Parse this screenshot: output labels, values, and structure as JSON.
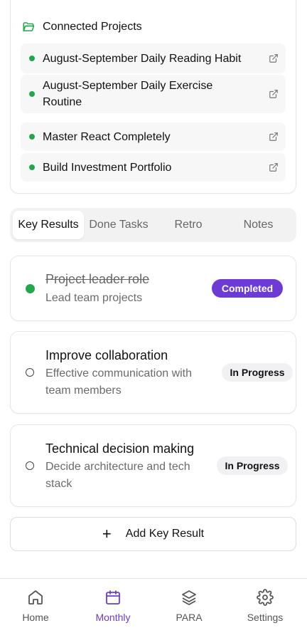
{
  "projects": {
    "title": "Connected Projects",
    "items": [
      {
        "name": "August-September Daily Reading Habit"
      },
      {
        "name": "August-September Daily Exercise Routine"
      },
      {
        "name": "Master React Completely"
      },
      {
        "name": "Build Investment Portfolio"
      }
    ]
  },
  "tabs": [
    "Key Results",
    "Done Tasks",
    "Retro",
    "Notes"
  ],
  "active_tab": "Key Results",
  "key_results": [
    {
      "title": "Project leader role",
      "desc": "Lead team projects",
      "status": "Completed",
      "done": true
    },
    {
      "title": "Improve collaboration",
      "desc": "Effective communication with team members",
      "status": "In Progress",
      "done": false
    },
    {
      "title": "Technical decision making",
      "desc": "Decide architecture and tech stack",
      "status": "In Progress",
      "done": false
    }
  ],
  "add_key_result": "Add Key Result",
  "nav": [
    {
      "label": "Home",
      "icon": "home-icon"
    },
    {
      "label": "Monthly",
      "icon": "calendar-icon"
    },
    {
      "label": "PARA",
      "icon": "layers-icon"
    },
    {
      "label": "Settings",
      "icon": "gear-icon"
    }
  ],
  "active_nav": "Monthly",
  "colors": {
    "accent": "#6d3ad6",
    "success": "#22a84a"
  }
}
